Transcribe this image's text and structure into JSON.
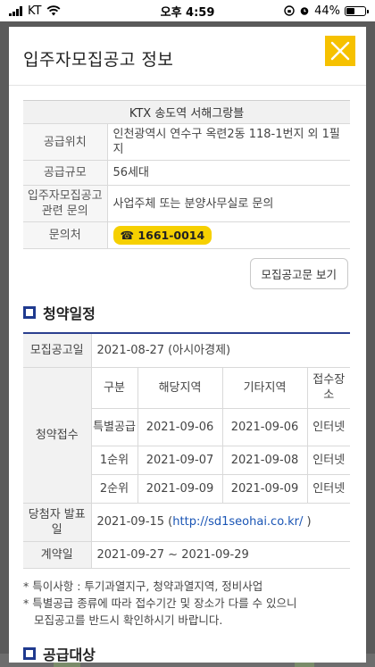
{
  "status_bar": {
    "carrier": "KT",
    "time": "오후 4:59",
    "battery": "44%",
    "battery_level": 0.44
  },
  "modal": {
    "title": "입주자모집공고 정보",
    "close_icon": "close-icon"
  },
  "info": {
    "complex_name": "KTX 송도역 서해그랑블",
    "rows": [
      {
        "label": "공급위치",
        "value": "인천광역시 연수구 옥련2동 118-1번지 외 1필지"
      },
      {
        "label": "공급규모",
        "value": "56세대"
      },
      {
        "label": "입주자모집공고 관련 문의",
        "value": "사업주체 또는 분양사무실로 문의"
      }
    ],
    "contact_label": "문의처",
    "phone": "☎ 1661-0014"
  },
  "notice_button": "모집공고문 보기",
  "schedule": {
    "section_title": "청약일정",
    "announce_label": "모집공고일",
    "announce_value": "2021-08-27 (아시아경제)",
    "apply_label": "청약접수",
    "headers": [
      "구분",
      "해당지역",
      "기타지역",
      "접수장소"
    ],
    "rows": [
      [
        "특별공급",
        "2021-09-06",
        "2021-09-06",
        "인터넷"
      ],
      [
        "1순위",
        "2021-09-07",
        "2021-09-08",
        "인터넷"
      ],
      [
        "2순위",
        "2021-09-09",
        "2021-09-09",
        "인터넷"
      ]
    ],
    "winner_label": "당첨자 발표일",
    "winner_date": "2021-09-15 (",
    "winner_link": "http://sd1seohai.co.kr/",
    "winner_close": " )",
    "contract_label": "계약일",
    "contract_value": "2021-09-27 ~ 2021-09-29"
  },
  "notes": {
    "line1": "* 특이사항 : 투기과열지구, 청약과열지역, 정비사업",
    "line2": "* 특별공급 종류에 따라 접수기간 및 장소가 다를 수 있으니",
    "line3": "모집공고를 반드시 확인하시기 바랍니다."
  },
  "supply_section_title": "공급대상",
  "colors": {
    "accent_yellow": "#f6c100",
    "section_navy": "#1f3a8f",
    "link_blue": "#1a55b5"
  }
}
